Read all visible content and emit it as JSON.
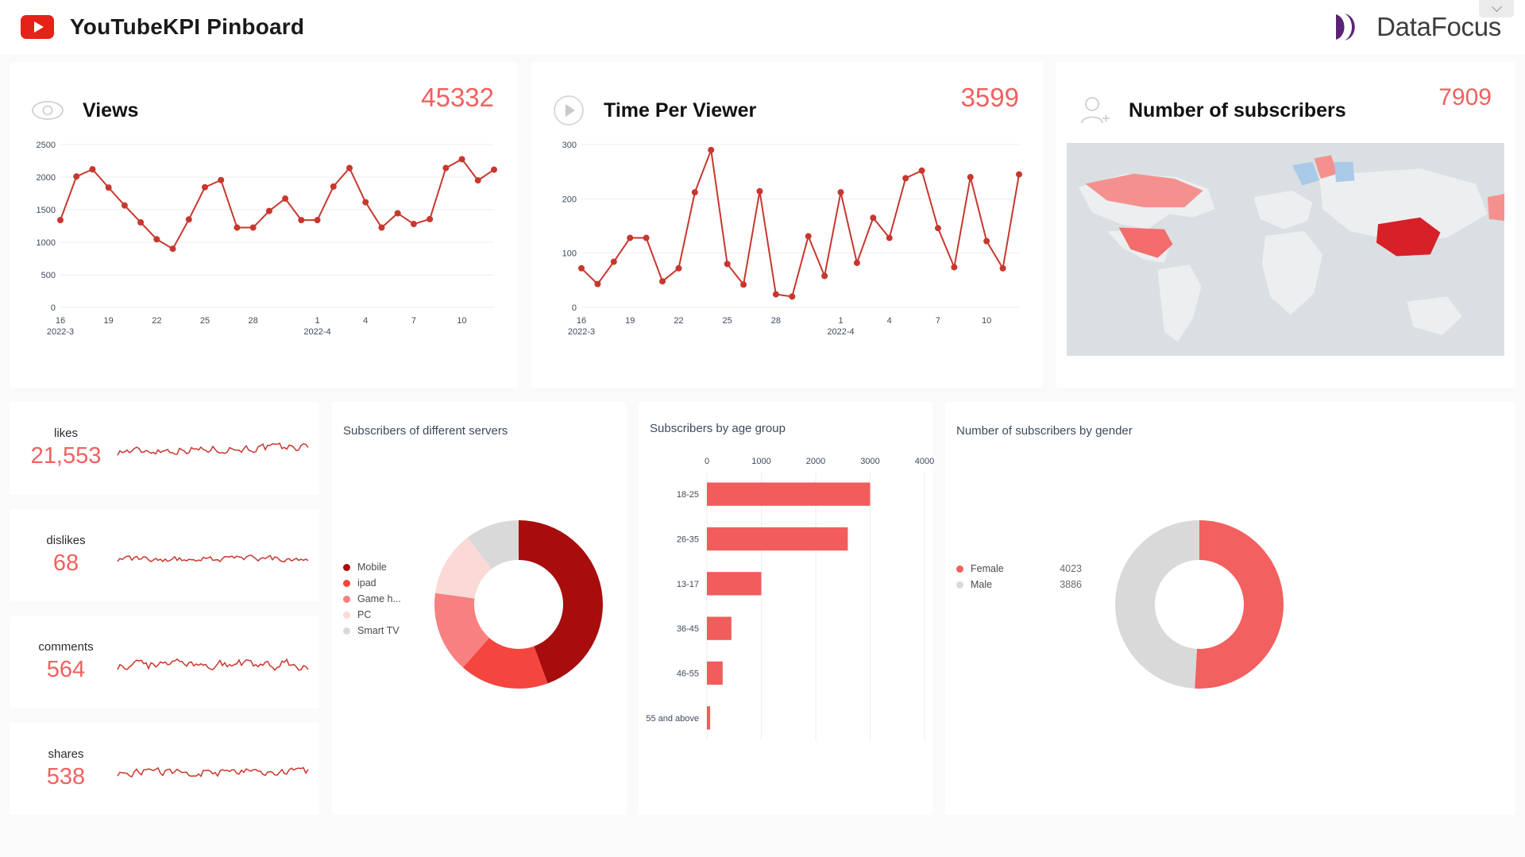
{
  "header": {
    "app_title": "YouTubeKPI Pinboard",
    "youtube_icon": "youtube-play-icon",
    "logo_text": "DataFocus",
    "logo_icon": "datafocus-logo-icon",
    "collapse_icon": "chevron-down-icon",
    "brand_color": "#e62117",
    "logo_color": "#5b2377"
  },
  "kpi": {
    "views": {
      "icon": "eye-icon",
      "title": "Views",
      "value": "45332"
    },
    "time": {
      "icon": "play-circle-icon",
      "title": "Time Per Viewer",
      "value": "3599"
    },
    "subs": {
      "icon": "user-add-icon",
      "title": "Number of subscribers",
      "value": "7909"
    }
  },
  "sparklines": [
    {
      "label": "likes",
      "value": "21,553"
    },
    {
      "label": "dislikes",
      "value": "68"
    },
    {
      "label": "comments",
      "value": "564"
    },
    {
      "label": "shares",
      "value": "538"
    }
  ],
  "panels": {
    "servers": "Subscribers of different servers",
    "age": "Subscribers by age group",
    "gender": "Number of subscribers by gender"
  },
  "chart_data": [
    {
      "type": "line",
      "title": "Views",
      "xlabel": "",
      "ylabel": "",
      "ylim": [
        0,
        2500
      ],
      "yticks": [
        0,
        500,
        1000,
        1500,
        2000,
        2500
      ],
      "xticks": [
        "16",
        "19",
        "22",
        "25",
        "28",
        "1",
        "4",
        "7",
        "10"
      ],
      "xtick_sub": {
        "16": "2022-3",
        "1": "2022-4"
      },
      "grid": true,
      "values": [
        1340,
        2010,
        2120,
        1840,
        1565,
        1305,
        1045,
        900,
        1350,
        1845,
        1955,
        1225,
        1225,
        1480,
        1670,
        1340,
        1340,
        1855,
        2140,
        1615,
        1225,
        1445,
        1280,
        1355,
        2140,
        2275,
        1950,
        2115
      ]
    },
    {
      "type": "line",
      "title": "Time Per Viewer",
      "xlabel": "",
      "ylabel": "",
      "ylim": [
        0,
        300
      ],
      "yticks": [
        0,
        100,
        200,
        300
      ],
      "xticks": [
        "16",
        "19",
        "22",
        "25",
        "28",
        "1",
        "4",
        "7",
        "10"
      ],
      "xtick_sub": {
        "16": "2022-3",
        "1": "2022-4"
      },
      "grid": true,
      "values": [
        72,
        43,
        84,
        128,
        128,
        48,
        72,
        212,
        290,
        80,
        42,
        214,
        24,
        20,
        131,
        58,
        212,
        82,
        165,
        128,
        238,
        252,
        146,
        74,
        240,
        122,
        72,
        245
      ]
    },
    {
      "type": "pie",
      "title": "Subscribers of different servers",
      "donut": true,
      "labels": [
        "Mobile",
        "ipad",
        "Game h...",
        "PC",
        "Smart TV"
      ],
      "values": [
        3512,
        1354,
        1235,
        985,
        823
      ],
      "colors": [
        "#a80d0d",
        "#f4453f",
        "#f98080",
        "#fad9d6",
        "#d9d9d9"
      ],
      "legend_position": "left"
    },
    {
      "type": "bar",
      "orientation": "horizontal",
      "title": "Subscribers by age group",
      "categories": [
        "18-25",
        "26-35",
        "13-17",
        "36-45",
        "46-55",
        "55 and above"
      ],
      "values": [
        3000,
        2590,
        1000,
        450,
        290,
        60
      ],
      "xticks": [
        0,
        1000,
        2000,
        3000,
        4000
      ],
      "xlim": [
        0,
        4000
      ],
      "color": "#f25c5c",
      "grid": true
    },
    {
      "type": "pie",
      "title": "Number of subscribers by gender",
      "donut": true,
      "labels": [
        "Female",
        "Male"
      ],
      "values": [
        4023,
        3886
      ],
      "colors": [
        "#f2605f",
        "#d9d9d9"
      ],
      "legend_position": "left"
    }
  ]
}
